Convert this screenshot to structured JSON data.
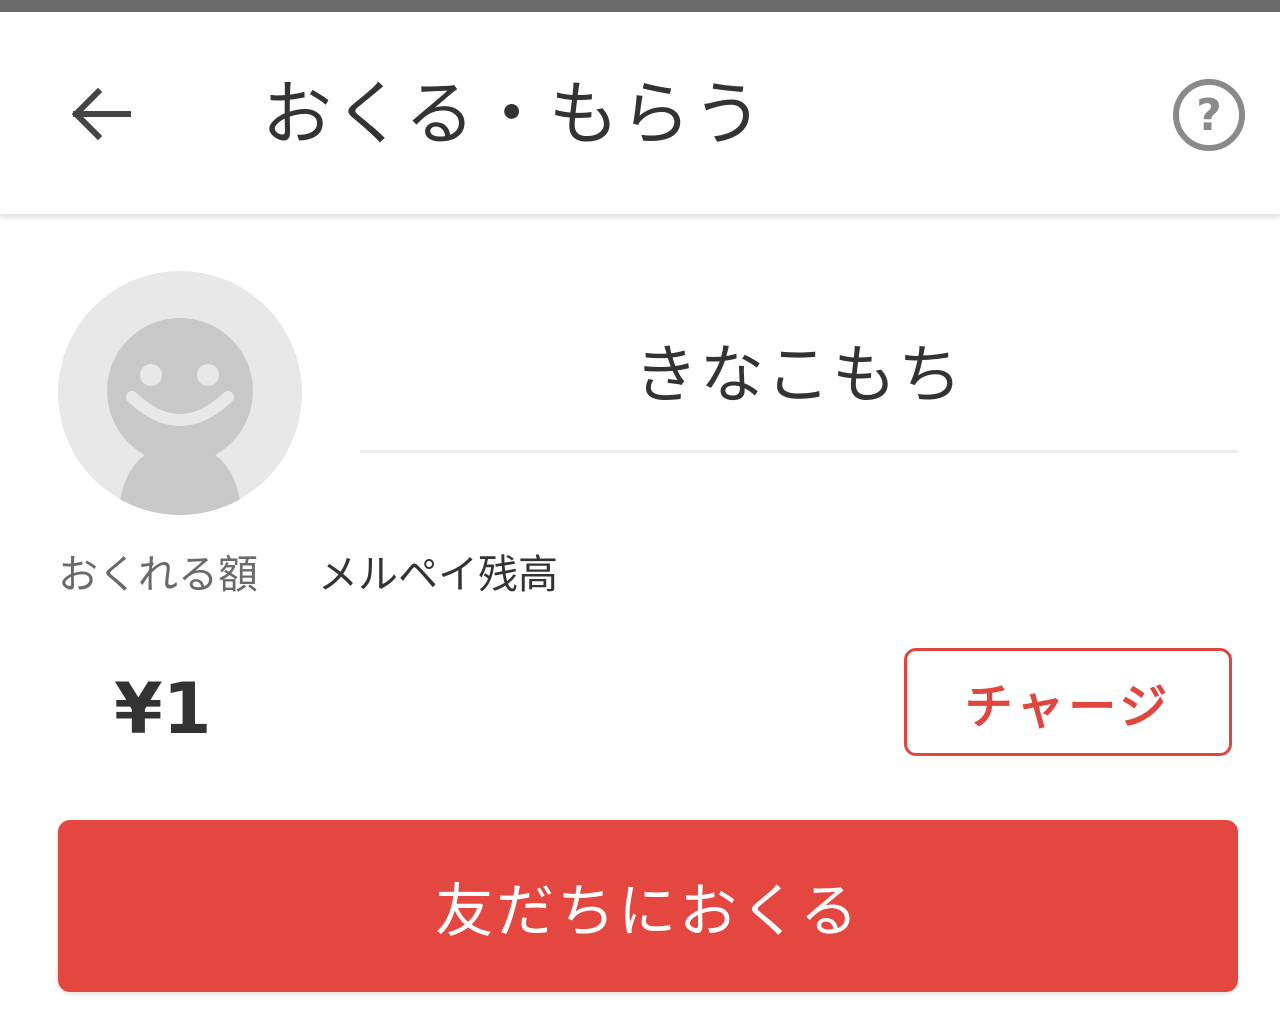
{
  "header": {
    "title": "おくる・もらう",
    "back_icon": "arrow-left-icon",
    "help_icon": "help-circle-icon"
  },
  "recipient": {
    "avatar_icon": "default-avatar-icon",
    "name": "きなこもち"
  },
  "amount": {
    "label": "おくれる額",
    "source": "メルペイ残高",
    "value": "¥1"
  },
  "buttons": {
    "charge_label": "チャージ",
    "send_label": "友だちにおくる"
  },
  "colors": {
    "accent": "#e3473f",
    "text": "#333333",
    "muted_text": "#6a6a6a",
    "avatar_bg": "#e8e8e8",
    "avatar_figure": "#c8c8c8"
  }
}
